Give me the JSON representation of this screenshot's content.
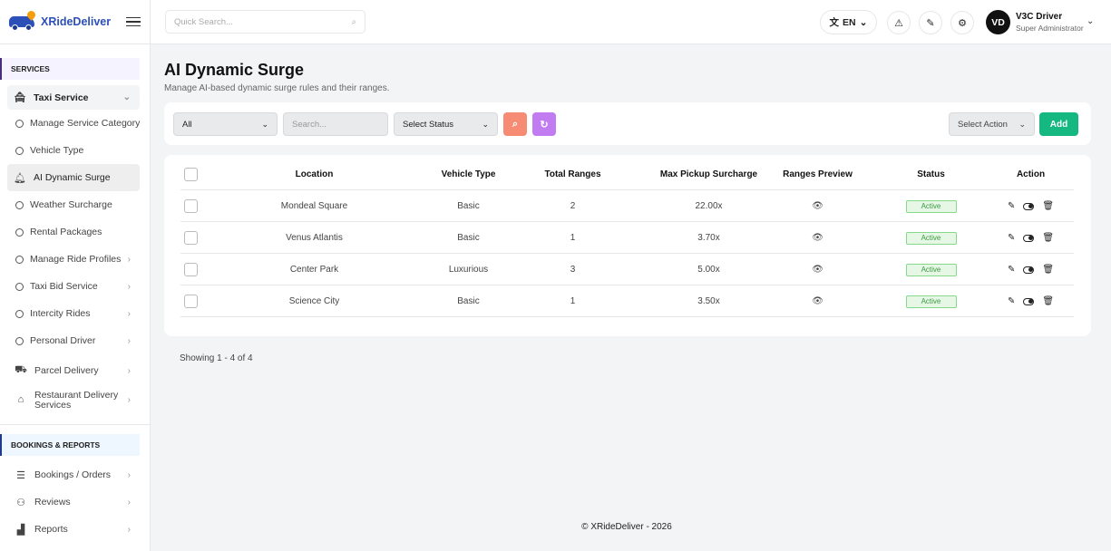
{
  "brand": {
    "name": "XRideDeliver"
  },
  "header": {
    "search_placeholder": "Quick Search...",
    "language": "EN",
    "avatar_initials": "VD",
    "user_name": "V3C Driver",
    "user_role": "Super Administrator"
  },
  "sidebar": {
    "services_label": "SERVICES",
    "taxi_service": "Taxi Service",
    "taxi_items": [
      "Manage Service Category",
      "Vehicle Type",
      "AI Dynamic Surge",
      "Weather Surcharge",
      "Rental Packages",
      "Manage Ride Profiles",
      "Taxi Bid Service",
      "Intercity Rides",
      "Personal Driver"
    ],
    "parcel_delivery": "Parcel Delivery",
    "restaurant_delivery": "Restaurant Delivery Services",
    "bookings_label": "BOOKINGS & REPORTS",
    "bookings_items": [
      "Bookings / Orders",
      "Reviews",
      "Reports"
    ]
  },
  "page": {
    "title": "AI Dynamic Surge",
    "subtitle": "Manage AI-based dynamic surge rules and their ranges."
  },
  "filters": {
    "scope": "All",
    "search_placeholder": "Search...",
    "status": "Select Status",
    "action": "Select Action",
    "add_label": "Add"
  },
  "colors": {
    "search_btn": "#f68c73",
    "refresh_btn": "#c27cf2",
    "add_btn": "#16b882",
    "brand": "#2c4fb8"
  },
  "table": {
    "headers": [
      "Location",
      "Vehicle Type",
      "Total Ranges",
      "Max Pickup Surcharge",
      "Ranges Preview",
      "Status",
      "Action"
    ],
    "rows": [
      {
        "location": "Mondeal Square",
        "vehicle": "Basic",
        "ranges": "2",
        "surcharge": "22.00x",
        "status": "Active"
      },
      {
        "location": "Venus Atlantis",
        "vehicle": "Basic",
        "ranges": "1",
        "surcharge": "3.70x",
        "status": "Active"
      },
      {
        "location": "Center Park",
        "vehicle": "Luxurious",
        "ranges": "3",
        "surcharge": "5.00x",
        "status": "Active"
      },
      {
        "location": "Science City",
        "vehicle": "Basic",
        "ranges": "1",
        "surcharge": "3.50x",
        "status": "Active"
      }
    ]
  },
  "pagination": {
    "text": "Showing 1 - 4 of 4"
  },
  "footer": {
    "text": "© XRideDeliver - 2026"
  }
}
